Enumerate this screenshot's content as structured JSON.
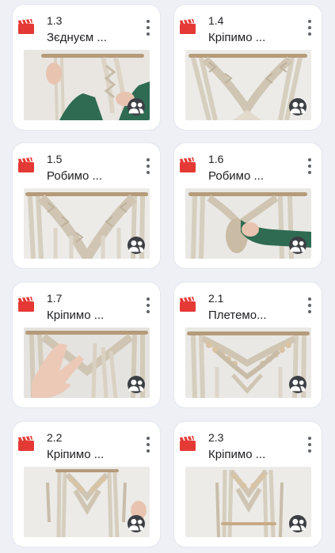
{
  "colors": {
    "page_bg": "#eef0f6",
    "card_bg": "#ffffff",
    "clapper_red": "#e53935",
    "shared_badge_bg": "#3c3f44"
  },
  "icons": {
    "video": "clapperboard-icon",
    "menu": "more-vert-icon",
    "shared": "people-icon"
  },
  "lessons": [
    {
      "number": "1.3",
      "title": "Зєднуєм ..."
    },
    {
      "number": "1.4",
      "title": "Кріпимо ..."
    },
    {
      "number": "1.5",
      "title": "Робимо ..."
    },
    {
      "number": "1.6",
      "title": "Робимо ..."
    },
    {
      "number": "1.7",
      "title": "Кріпимо ..."
    },
    {
      "number": "2.1",
      "title": "Плетемо..."
    },
    {
      "number": "2.2",
      "title": "Кріпимо ..."
    },
    {
      "number": "2.3",
      "title": "Кріпимо ..."
    }
  ]
}
